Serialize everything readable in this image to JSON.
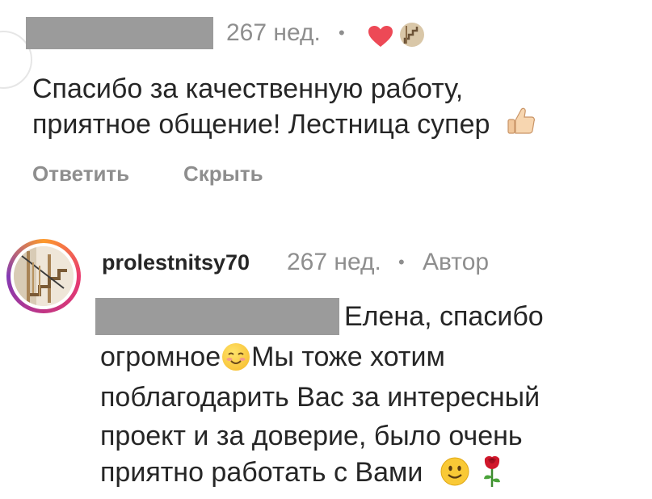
{
  "comment": {
    "time": "267 нед.",
    "dot": "•",
    "text_line1": "Спасибо за качественную работу,",
    "text_line2": "приятное общение! Лестница супер",
    "reply_label": "Ответить",
    "hide_label": "Скрыть"
  },
  "reply": {
    "username": "prolestnitsy70",
    "time": "267 нед.",
    "dot": "•",
    "author_label": "Автор",
    "line1": "Елена, спасибо",
    "line2a": "огромное",
    "line2b": "Мы тоже хотим",
    "line3": "поблагодарить Вас за интересный",
    "line4": "проект и за доверие, было очень",
    "line5": "приятно работать с Вами"
  },
  "colors": {
    "heart": "#ed4956",
    "meta_text": "#8e8e8e",
    "redaction": "#9b9b9b"
  }
}
